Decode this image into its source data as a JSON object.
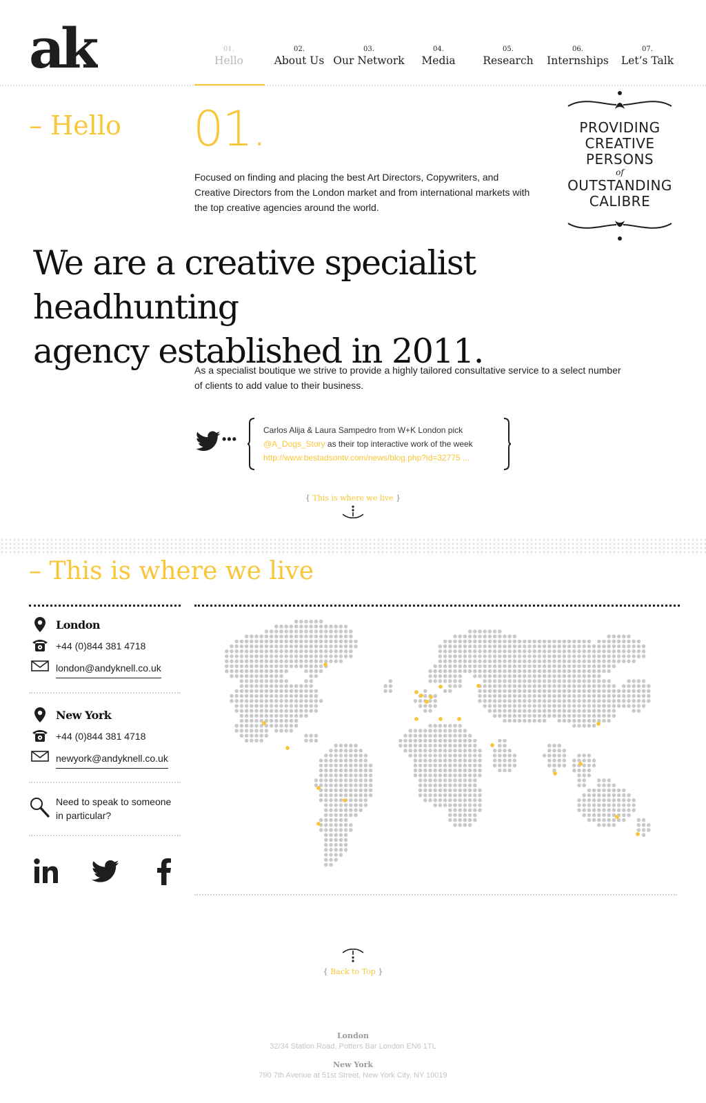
{
  "brand": {
    "logo_text": "ak"
  },
  "colors": {
    "accent": "#f8c637",
    "text": "#1e1e1e",
    "muted": "#b9b9b9",
    "map_dot": "#c9c9c9"
  },
  "nav": {
    "items": [
      {
        "num": "01.",
        "label": "Hello",
        "active": true
      },
      {
        "num": "02.",
        "label": "About Us"
      },
      {
        "num": "03.",
        "label": "Our Network"
      },
      {
        "num": "04.",
        "label": "Media"
      },
      {
        "num": "05.",
        "label": "Research"
      },
      {
        "num": "06.",
        "label": "Internships"
      },
      {
        "num": "07.",
        "label": "Let’s Talk"
      }
    ]
  },
  "hello": {
    "heading": "– Hello",
    "number": "01.",
    "intro": "Focused on finding and placing the best Art Directors, Copywriters, and Creative Directors from the London market and from international markets with the top creative agencies around the world.",
    "badge": {
      "line1": "PROVIDING",
      "line2": "CREATIVE",
      "line3": "PERSONS",
      "of": "of",
      "line4": "OUTSTANDING",
      "line5": "CALIBRE"
    },
    "statement_line1": "We are a creative specialist headhunting",
    "statement_line2": "agency established in 2011.",
    "boutique": "As a specialist boutique we strive to provide a highly tailored consultative service to a select number of clients to add value to their business.",
    "tweet": {
      "line1": "Carlos Alija & Laura Sampedro from W+K London pick",
      "handle": "@A_Dogs_Story",
      "line2_rest": " as their top interactive work of the week",
      "url": "http://www.bestadsontv.com/news/blog.php?id=32775 ..."
    },
    "dots": "•••",
    "live_link": {
      "open": "{ ",
      "label": "This is where we live",
      "close": " }"
    }
  },
  "live": {
    "heading": "– This is where we live",
    "offices": [
      {
        "city": "London",
        "phone": "+44 (0)844 381 4718",
        "email": "london@andyknell.co.uk"
      },
      {
        "city": "New York",
        "phone": "+44 (0)844 381 4718",
        "email": "newyork@andyknell.co.uk"
      }
    ],
    "speak": "Need to speak to someone in particular?",
    "social": [
      "linkedin-icon",
      "twitter-icon",
      "facebook-icon"
    ]
  },
  "back_to_top": {
    "open": "{ ",
    "label": "Back to Top",
    "close": " }"
  },
  "footer": {
    "london_city": "London",
    "london_address": "32/34 Station Road, Potters Bar  London EN6 1TL",
    "ny_city": "New York",
    "ny_address": "790 7th Avenue at 51st Street, New York City, NY 10019"
  }
}
